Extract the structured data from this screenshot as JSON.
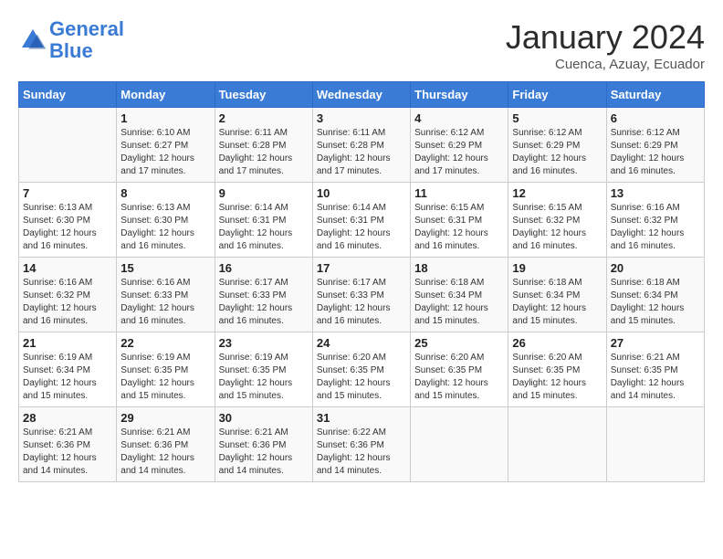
{
  "header": {
    "logo_line1": "General",
    "logo_line2": "Blue",
    "month": "January 2024",
    "location": "Cuenca, Azuay, Ecuador"
  },
  "weekdays": [
    "Sunday",
    "Monday",
    "Tuesday",
    "Wednesday",
    "Thursday",
    "Friday",
    "Saturday"
  ],
  "weeks": [
    [
      {
        "day": "",
        "sunrise": "",
        "sunset": "",
        "daylight": ""
      },
      {
        "day": "1",
        "sunrise": "Sunrise: 6:10 AM",
        "sunset": "Sunset: 6:27 PM",
        "daylight": "Daylight: 12 hours and 17 minutes."
      },
      {
        "day": "2",
        "sunrise": "Sunrise: 6:11 AM",
        "sunset": "Sunset: 6:28 PM",
        "daylight": "Daylight: 12 hours and 17 minutes."
      },
      {
        "day": "3",
        "sunrise": "Sunrise: 6:11 AM",
        "sunset": "Sunset: 6:28 PM",
        "daylight": "Daylight: 12 hours and 17 minutes."
      },
      {
        "day": "4",
        "sunrise": "Sunrise: 6:12 AM",
        "sunset": "Sunset: 6:29 PM",
        "daylight": "Daylight: 12 hours and 17 minutes."
      },
      {
        "day": "5",
        "sunrise": "Sunrise: 6:12 AM",
        "sunset": "Sunset: 6:29 PM",
        "daylight": "Daylight: 12 hours and 16 minutes."
      },
      {
        "day": "6",
        "sunrise": "Sunrise: 6:12 AM",
        "sunset": "Sunset: 6:29 PM",
        "daylight": "Daylight: 12 hours and 16 minutes."
      }
    ],
    [
      {
        "day": "7",
        "sunrise": "Sunrise: 6:13 AM",
        "sunset": "Sunset: 6:30 PM",
        "daylight": "Daylight: 12 hours and 16 minutes."
      },
      {
        "day": "8",
        "sunrise": "Sunrise: 6:13 AM",
        "sunset": "Sunset: 6:30 PM",
        "daylight": "Daylight: 12 hours and 16 minutes."
      },
      {
        "day": "9",
        "sunrise": "Sunrise: 6:14 AM",
        "sunset": "Sunset: 6:31 PM",
        "daylight": "Daylight: 12 hours and 16 minutes."
      },
      {
        "day": "10",
        "sunrise": "Sunrise: 6:14 AM",
        "sunset": "Sunset: 6:31 PM",
        "daylight": "Daylight: 12 hours and 16 minutes."
      },
      {
        "day": "11",
        "sunrise": "Sunrise: 6:15 AM",
        "sunset": "Sunset: 6:31 PM",
        "daylight": "Daylight: 12 hours and 16 minutes."
      },
      {
        "day": "12",
        "sunrise": "Sunrise: 6:15 AM",
        "sunset": "Sunset: 6:32 PM",
        "daylight": "Daylight: 12 hours and 16 minutes."
      },
      {
        "day": "13",
        "sunrise": "Sunrise: 6:16 AM",
        "sunset": "Sunset: 6:32 PM",
        "daylight": "Daylight: 12 hours and 16 minutes."
      }
    ],
    [
      {
        "day": "14",
        "sunrise": "Sunrise: 6:16 AM",
        "sunset": "Sunset: 6:32 PM",
        "daylight": "Daylight: 12 hours and 16 minutes."
      },
      {
        "day": "15",
        "sunrise": "Sunrise: 6:16 AM",
        "sunset": "Sunset: 6:33 PM",
        "daylight": "Daylight: 12 hours and 16 minutes."
      },
      {
        "day": "16",
        "sunrise": "Sunrise: 6:17 AM",
        "sunset": "Sunset: 6:33 PM",
        "daylight": "Daylight: 12 hours and 16 minutes."
      },
      {
        "day": "17",
        "sunrise": "Sunrise: 6:17 AM",
        "sunset": "Sunset: 6:33 PM",
        "daylight": "Daylight: 12 hours and 16 minutes."
      },
      {
        "day": "18",
        "sunrise": "Sunrise: 6:18 AM",
        "sunset": "Sunset: 6:34 PM",
        "daylight": "Daylight: 12 hours and 15 minutes."
      },
      {
        "day": "19",
        "sunrise": "Sunrise: 6:18 AM",
        "sunset": "Sunset: 6:34 PM",
        "daylight": "Daylight: 12 hours and 15 minutes."
      },
      {
        "day": "20",
        "sunrise": "Sunrise: 6:18 AM",
        "sunset": "Sunset: 6:34 PM",
        "daylight": "Daylight: 12 hours and 15 minutes."
      }
    ],
    [
      {
        "day": "21",
        "sunrise": "Sunrise: 6:19 AM",
        "sunset": "Sunset: 6:34 PM",
        "daylight": "Daylight: 12 hours and 15 minutes."
      },
      {
        "day": "22",
        "sunrise": "Sunrise: 6:19 AM",
        "sunset": "Sunset: 6:35 PM",
        "daylight": "Daylight: 12 hours and 15 minutes."
      },
      {
        "day": "23",
        "sunrise": "Sunrise: 6:19 AM",
        "sunset": "Sunset: 6:35 PM",
        "daylight": "Daylight: 12 hours and 15 minutes."
      },
      {
        "day": "24",
        "sunrise": "Sunrise: 6:20 AM",
        "sunset": "Sunset: 6:35 PM",
        "daylight": "Daylight: 12 hours and 15 minutes."
      },
      {
        "day": "25",
        "sunrise": "Sunrise: 6:20 AM",
        "sunset": "Sunset: 6:35 PM",
        "daylight": "Daylight: 12 hours and 15 minutes."
      },
      {
        "day": "26",
        "sunrise": "Sunrise: 6:20 AM",
        "sunset": "Sunset: 6:35 PM",
        "daylight": "Daylight: 12 hours and 15 minutes."
      },
      {
        "day": "27",
        "sunrise": "Sunrise: 6:21 AM",
        "sunset": "Sunset: 6:35 PM",
        "daylight": "Daylight: 12 hours and 14 minutes."
      }
    ],
    [
      {
        "day": "28",
        "sunrise": "Sunrise: 6:21 AM",
        "sunset": "Sunset: 6:36 PM",
        "daylight": "Daylight: 12 hours and 14 minutes."
      },
      {
        "day": "29",
        "sunrise": "Sunrise: 6:21 AM",
        "sunset": "Sunset: 6:36 PM",
        "daylight": "Daylight: 12 hours and 14 minutes."
      },
      {
        "day": "30",
        "sunrise": "Sunrise: 6:21 AM",
        "sunset": "Sunset: 6:36 PM",
        "daylight": "Daylight: 12 hours and 14 minutes."
      },
      {
        "day": "31",
        "sunrise": "Sunrise: 6:22 AM",
        "sunset": "Sunset: 6:36 PM",
        "daylight": "Daylight: 12 hours and 14 minutes."
      },
      {
        "day": "",
        "sunrise": "",
        "sunset": "",
        "daylight": ""
      },
      {
        "day": "",
        "sunrise": "",
        "sunset": "",
        "daylight": ""
      },
      {
        "day": "",
        "sunrise": "",
        "sunset": "",
        "daylight": ""
      }
    ]
  ]
}
